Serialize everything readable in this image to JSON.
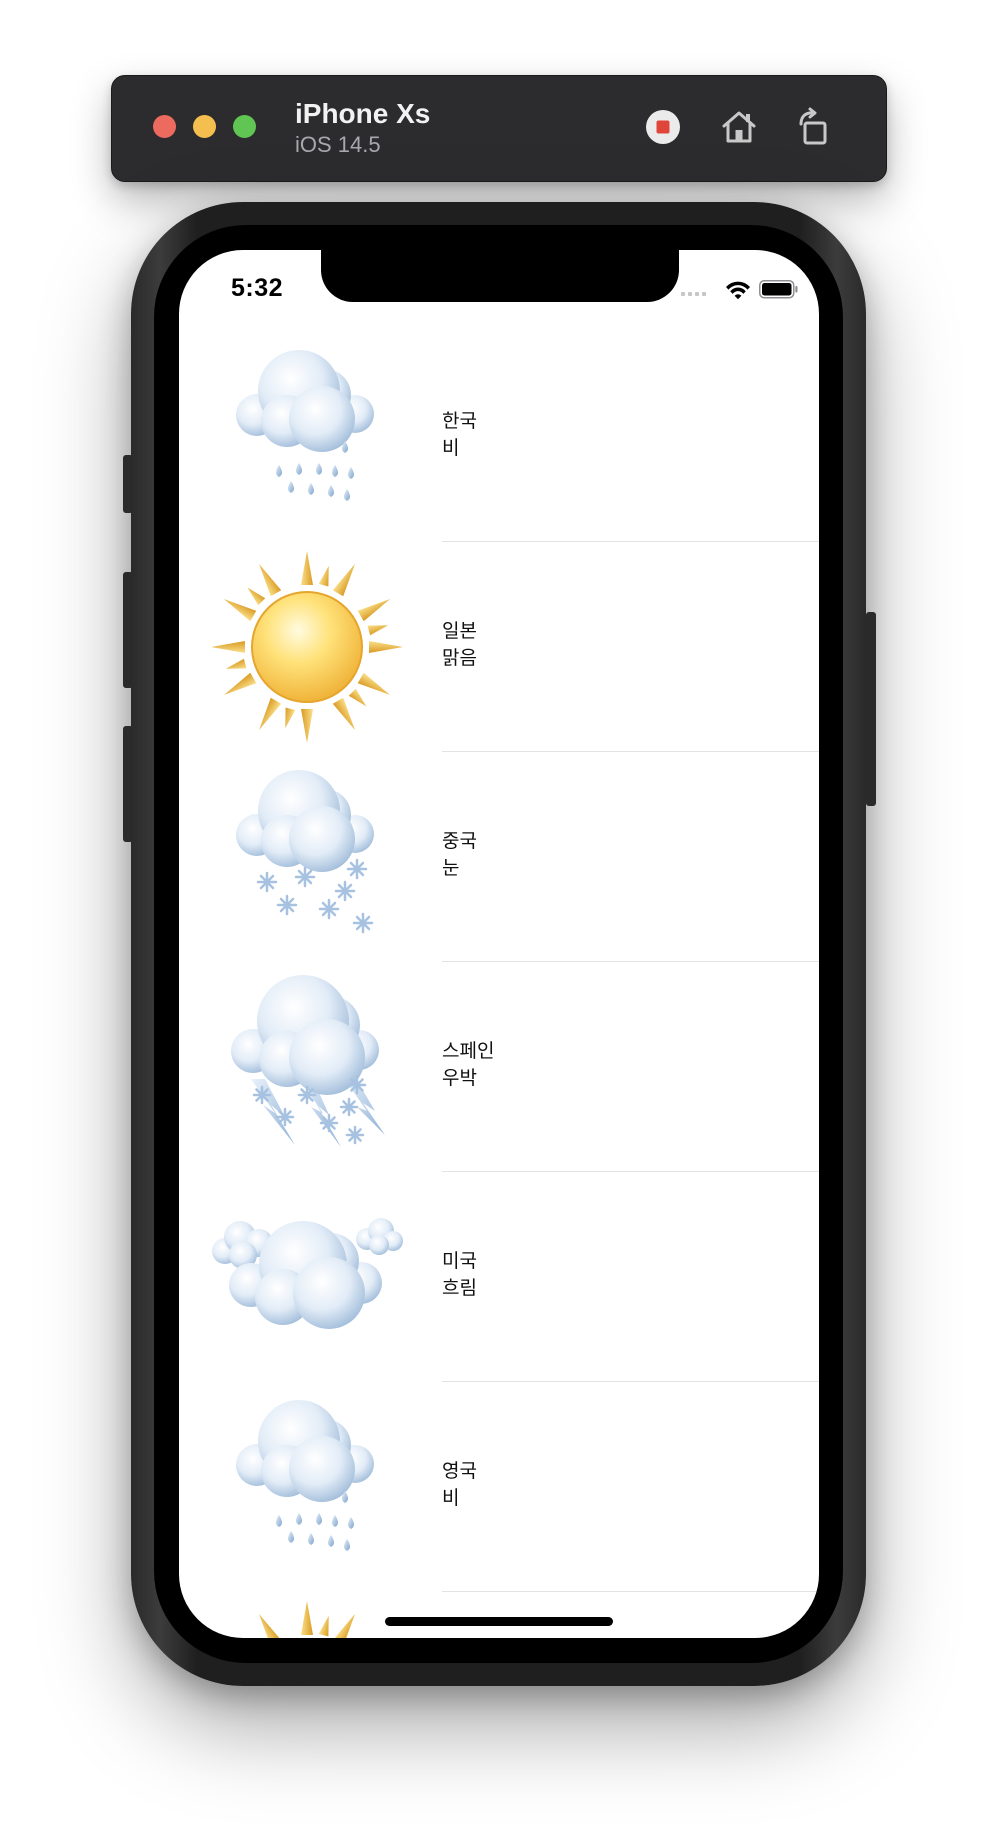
{
  "simulator": {
    "device_name": "iPhone Xs",
    "os_version": "iOS 14.5"
  },
  "status_bar": {
    "time": "5:32"
  },
  "weather_list": [
    {
      "country": "한국",
      "weather": "비",
      "icon": "rain-icon"
    },
    {
      "country": "일본",
      "weather": "맑음",
      "icon": "sun-icon"
    },
    {
      "country": "중국",
      "weather": "눈",
      "icon": "snow-icon"
    },
    {
      "country": "스페인",
      "weather": "우박",
      "icon": "hail-icon"
    },
    {
      "country": "미국",
      "weather": "흐림",
      "icon": "cloudy-icon"
    },
    {
      "country": "영국",
      "weather": "비",
      "icon": "rain-icon"
    },
    {
      "country": "",
      "weather": "",
      "icon": "sun-icon"
    }
  ],
  "colors": {
    "cloud_light": "#f4f8fd",
    "cloud_dark": "#9fbbd9",
    "sun_light": "#fff3b0",
    "sun_dark": "#f0b43a",
    "separator": "#e3e3e6"
  }
}
